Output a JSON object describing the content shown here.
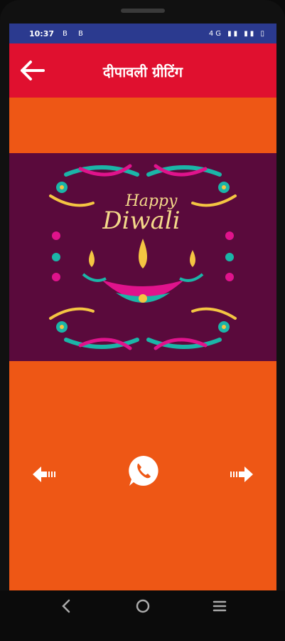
{
  "status_bar": {
    "time": "10:37",
    "left_icons": "B B",
    "right_icons": "4G ▮▮ ▮▮ ▯"
  },
  "app_bar": {
    "title": "दीपावली ग्रीटिंग"
  },
  "card": {
    "line1": "Happy",
    "line2": "Diwali"
  },
  "colors": {
    "background": "#ee5715",
    "appbar": "#e0102f",
    "statusbar": "#2b3a8f",
    "card_bg": "#5a0a3c"
  },
  "icons": {
    "back": "arrow-left-icon",
    "prev": "arrow-left-icon",
    "next": "arrow-right-icon",
    "share": "whatsapp-icon"
  }
}
